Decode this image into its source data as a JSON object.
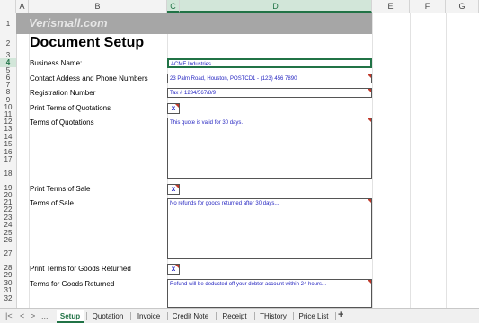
{
  "columns": [
    "A",
    "B",
    "C",
    "D",
    "E",
    "F",
    "G"
  ],
  "rows": [
    "1",
    "2",
    "3",
    "4",
    "5",
    "6",
    "7",
    "8",
    "9",
    "10",
    "11",
    "12",
    "13",
    "14",
    "15",
    "16",
    "17",
    "18",
    "19",
    "20",
    "21",
    "22",
    "23",
    "24",
    "25",
    "26",
    "27",
    "28",
    "29",
    "30",
    "31",
    "32"
  ],
  "banner": "Verismall.com",
  "title": "Document Setup",
  "labels": {
    "business_name": "Business Name:",
    "contact": "Contact Addess and Phone Numbers",
    "registration": "Registration Number",
    "print_quotations": "Print Terms of Quotations",
    "terms_quotations": "Terms of Quotations",
    "print_sale": "Print Terms of Sale",
    "terms_sale": "Terms of Sale",
    "print_returned": "Print Terms for Goods Returned",
    "terms_returned": "Terms for Goods Returned"
  },
  "values": {
    "business_name": "ACME Industries",
    "contact": "23 Palm Road, Houston, POSTCD1 - (123) 456 7890",
    "registration": "Tax # 1234/567/8/9",
    "print_quotations": "x",
    "terms_quotations": "This quote is valid for 30 days.",
    "print_sale": "x",
    "terms_sale": "No refunds for goods returned after 30 days...",
    "print_returned": "x",
    "terms_returned": "Refund will be deducted off your debtor account within 24 hours..."
  },
  "tabs": [
    "Setup",
    "Quotation",
    "Invoice",
    "Credit Note",
    "Receipt",
    "THistory",
    "Price List"
  ],
  "add_tab": "+",
  "nav": {
    "first": "|<",
    "prev": "<",
    "next": ">",
    "last": ">|",
    "more": "..."
  }
}
